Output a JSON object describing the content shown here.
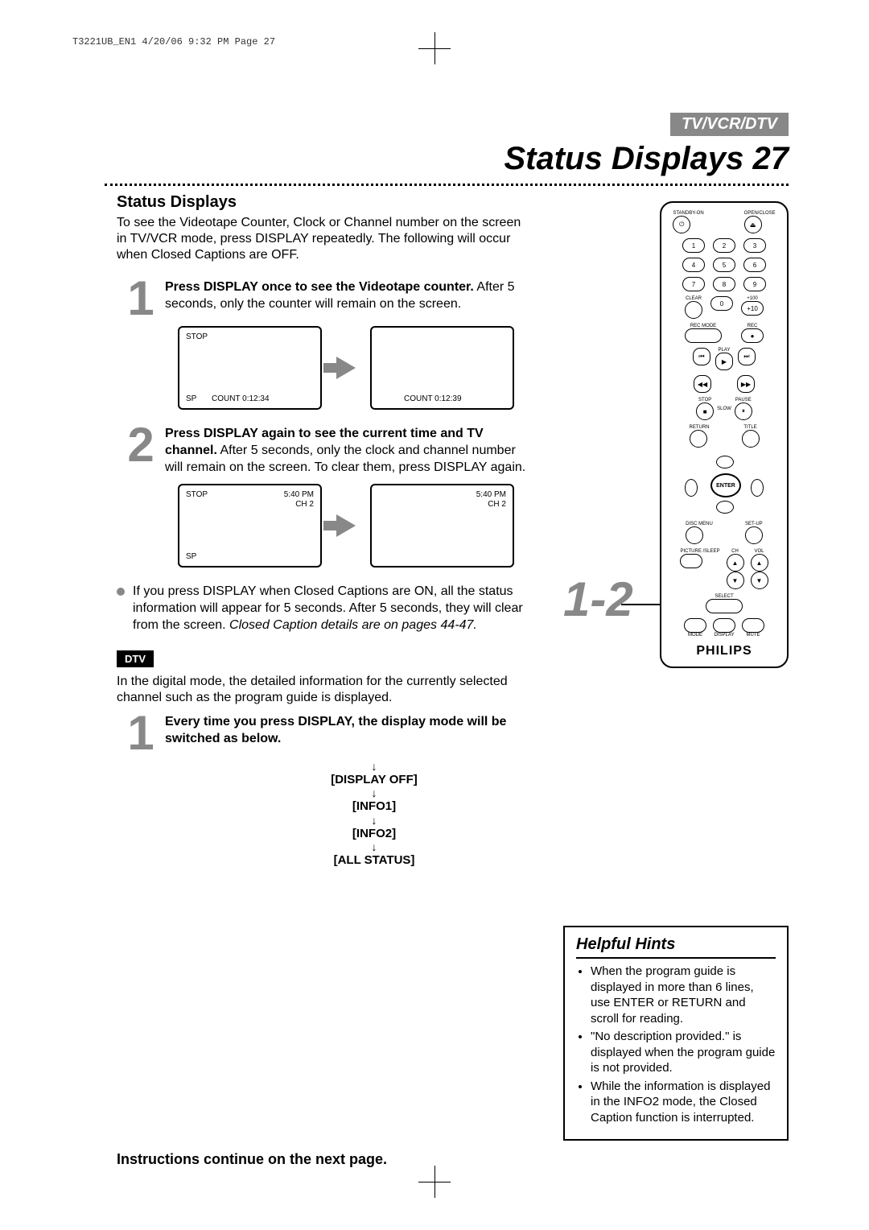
{
  "header": {
    "running_head": "T3221UB_EN1  4/20/06  9:32 PM  Page 27",
    "section_band": "TV/VCR/DTV",
    "page_title": "Status Displays",
    "page_number": "27"
  },
  "main": {
    "section_head": "Status Displays",
    "intro": "To see the Videotape Counter, Clock or Channel number on the screen in TV/VCR mode, press DISPLAY repeatedly. The following will occur when Closed Captions are OFF.",
    "step1_num": "1",
    "step1_bold": "Press DISPLAY once to see the Videotape counter.",
    "step1_rest": " After 5 seconds, only the counter will remain on the screen.",
    "osd1_a": {
      "tl": "STOP",
      "bl": "SP",
      "bc": "COUNT  0:12:34"
    },
    "osd1_b": {
      "bc": "COUNT  0:12:39"
    },
    "step2_num": "2",
    "step2_bold": "Press DISPLAY again to see the current time and TV channel.",
    "step2_rest": " After 5 seconds, only the clock and channel number will remain on the screen. To clear them, press DISPLAY again.",
    "osd2_a": {
      "tl": "STOP",
      "tr1": "5:40 PM",
      "tr2": "CH 2",
      "bl": "SP"
    },
    "osd2_b": {
      "tr1": "5:40 PM",
      "tr2": "CH 2"
    },
    "bullet1": "If you press DISPLAY when Closed Captions are ON, all the status information will appear for 5 seconds. After 5 seconds, they will clear from the screen. ",
    "bullet1_em": "Closed Caption details are on pages 44-47.",
    "dtv_badge": "DTV",
    "dtv_intro": "In the digital mode, the detailed information for the currently selected channel such as the program guide is displayed.",
    "dtv_step1_num": "1",
    "dtv_step1_bold": "Every time you press DISPLAY, the display mode will be switched as below.",
    "mode_cycle": {
      "a": "[DISPLAY OFF]",
      "b": "[INFO1]",
      "c": "[INFO2]",
      "d": "[ALL STATUS]"
    },
    "continue_note": "Instructions continue on the next page."
  },
  "remote": {
    "callout": "1-2",
    "standby": "STANDBY-ON",
    "openclose": "OPEN/CLOSE",
    "numbers": [
      "1",
      "2",
      "3",
      "4",
      "5",
      "6",
      "7",
      "8",
      "9",
      "0"
    ],
    "clear": "CLEAR",
    "plus100": "+100",
    "plus10": "+10",
    "recmode": "REC MODE",
    "rec": "REC",
    "play": "PLAY",
    "stop": "STOP",
    "slow": "SLOW",
    "pause": "PAUSE",
    "ret": "RETURN",
    "title": "TITLE",
    "enter": "ENTER",
    "disc_menu": "DISC MENU",
    "setup": "SET-UP",
    "picture_sleep": "PICTURE /SLEEP",
    "ch": "CH",
    "vol": "VOL",
    "select": "SELECT",
    "mode": "MODE",
    "display": "DISPLAY",
    "mute": "MUTE",
    "brand": "PHILIPS"
  },
  "hints": {
    "title": "Helpful Hints",
    "items": [
      "When the program guide is displayed in more than 6 lines, use ENTER or RETURN and scroll for reading.",
      "\"No description provided.\" is displayed when the program guide is not provided.",
      "While the information is displayed in the INFO2 mode, the Closed Caption function is interrupted."
    ]
  }
}
